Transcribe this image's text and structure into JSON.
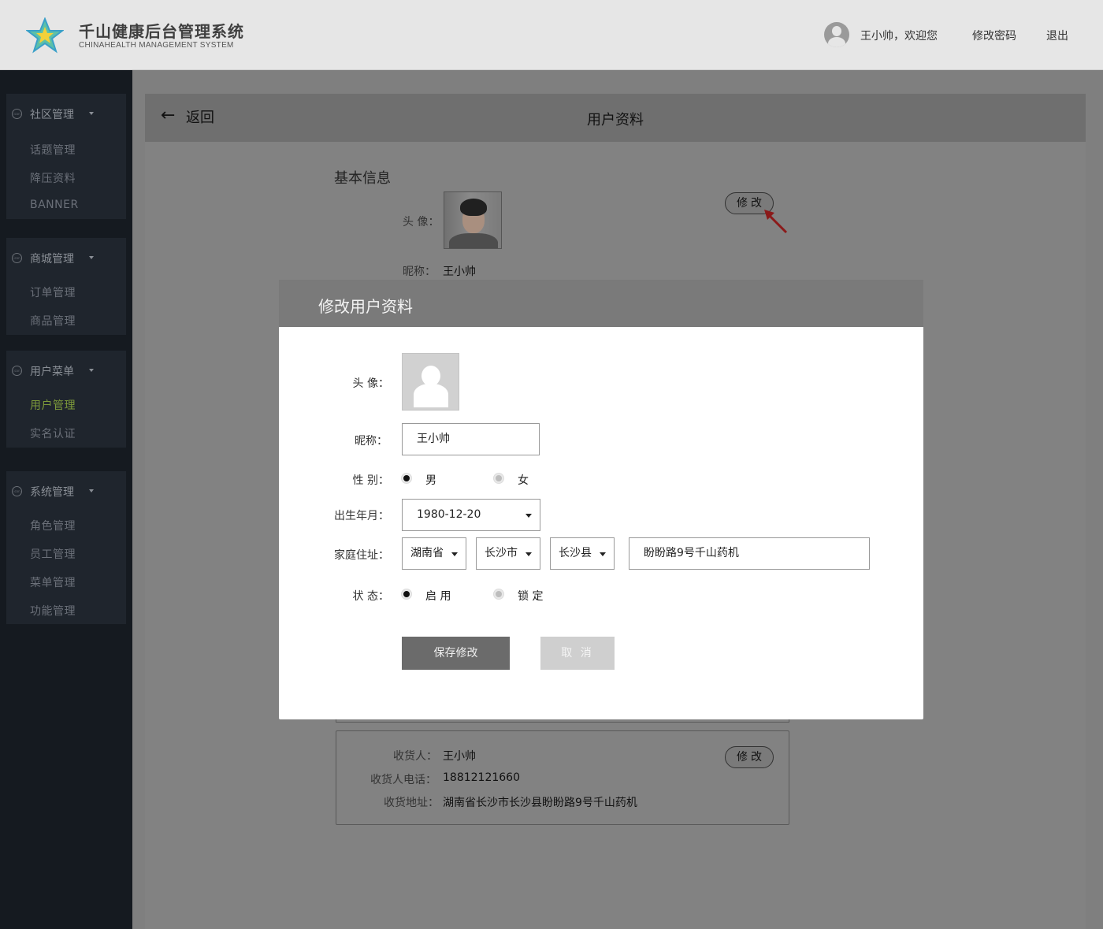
{
  "header": {
    "title": "千山健康后台管理系统",
    "subtitle": "CHINAHEALTH  MANAGEMENT SYSTEM",
    "welcome": "王小帅，欢迎您",
    "change_password": "修改密码",
    "logout": "退出"
  },
  "sidebar": {
    "groups": [
      {
        "title": "社区管理",
        "items": [
          "话题管理",
          "降压资料",
          "BANNER"
        ]
      },
      {
        "title": "商城管理",
        "items": [
          "订单管理",
          "商品管理"
        ]
      },
      {
        "title": "用户菜单",
        "items": [
          "用户管理",
          "实名认证"
        ]
      },
      {
        "title": "系统管理",
        "items": [
          "角色管理",
          "员工管理",
          "菜单管理",
          "功能管理"
        ]
      }
    ],
    "active_item": "用户管理"
  },
  "panel": {
    "back": "返回",
    "title": "用户资料",
    "section_basic": "基本信息",
    "avatar_label": "头 像：",
    "nickname_label": "昵称：",
    "nickname_value": "王小帅",
    "edit_button": "修改"
  },
  "shipping": {
    "receiver_label": "收货人：",
    "receiver_value": "王小帅",
    "phone_label": "收货人电话：",
    "phone_value": "18812121660",
    "address_label": "收货地址：",
    "address_value": "湖南省长沙市长沙县盼盼路9号千山药机",
    "edit_button": "修改"
  },
  "modal": {
    "title": "修改用户资料",
    "avatar_label": "头 像：",
    "nickname_label": "昵称：",
    "nickname_value": "王小帅",
    "gender_label": "性 别：",
    "gender_options": [
      "男",
      "女"
    ],
    "gender_selected": "男",
    "birth_label": "出生年月：",
    "birth_value": "1980-12-20",
    "address_label": "家庭住址：",
    "province": "湖南省",
    "city": "长沙市",
    "county": "长沙县",
    "street": "盼盼路9号千山药机",
    "status_label": "状 态：",
    "status_options": [
      "启 用",
      "锁 定"
    ],
    "status_selected": "启 用",
    "save_button": "保存修改",
    "cancel_button": "取 消"
  },
  "colors": {
    "sidebar_bg": "#151a20",
    "active_menu": "#7d9a3a",
    "modal_header": "#7a7a7a",
    "save_button": "#6b6b6b",
    "arrow": "#8b1a1a"
  }
}
